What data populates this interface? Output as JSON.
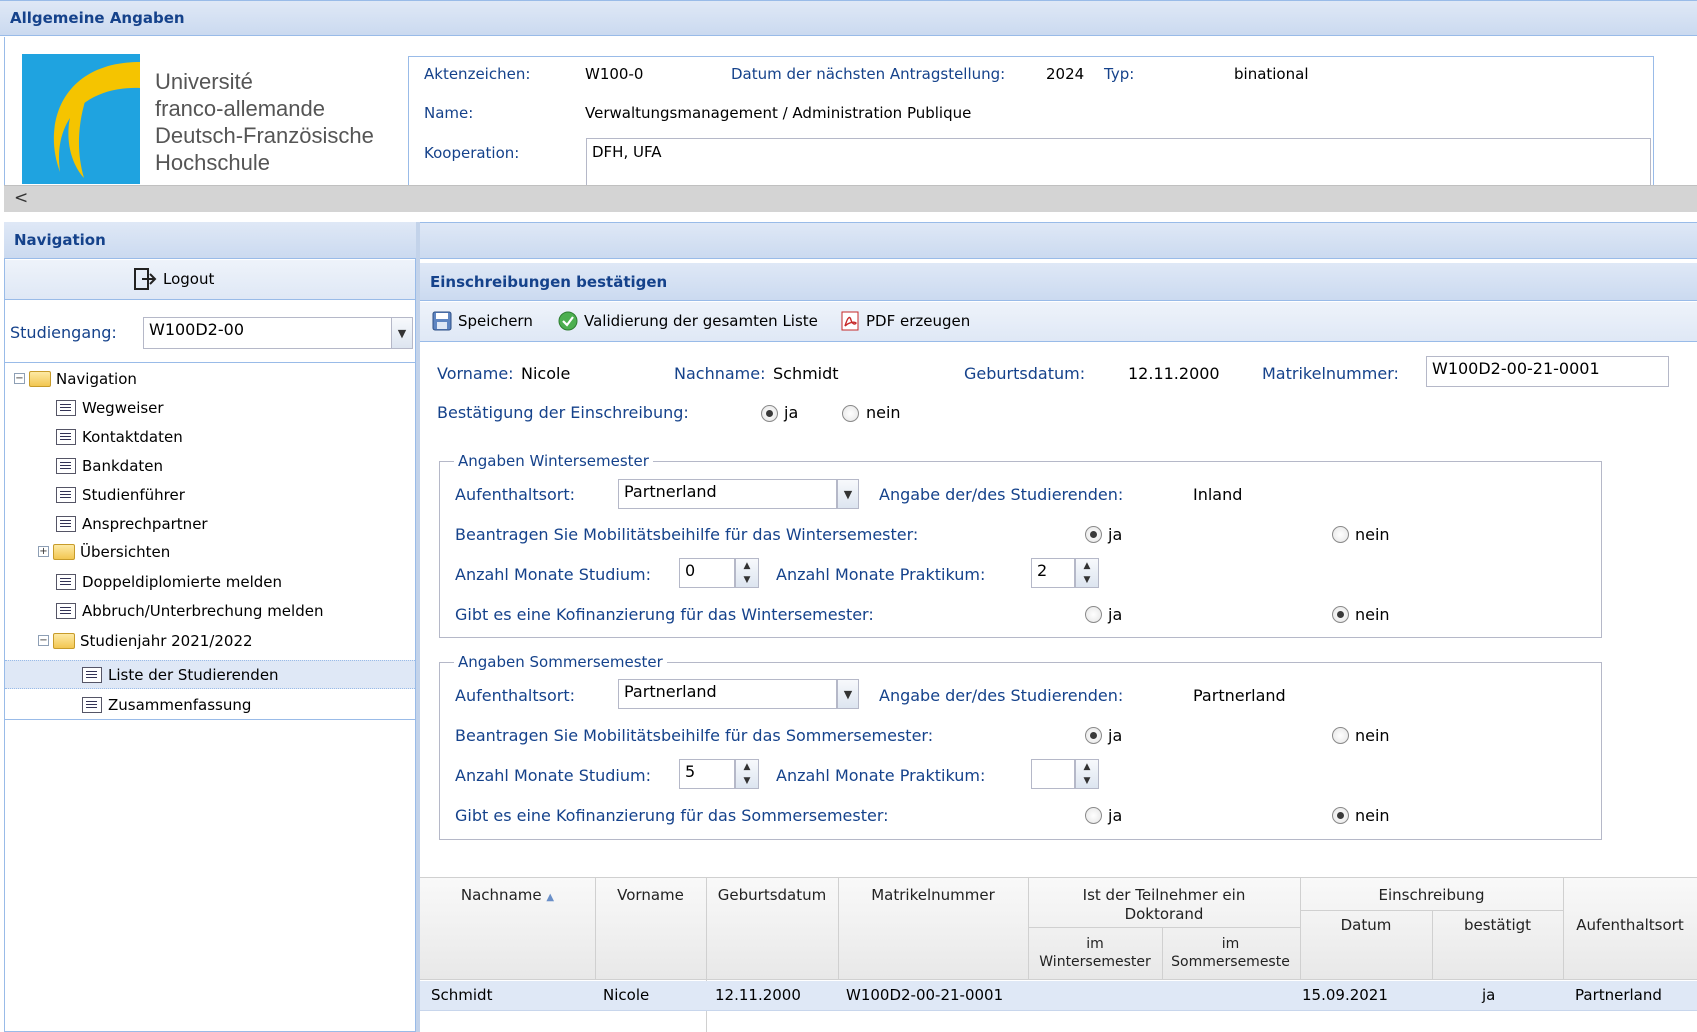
{
  "top_panel": {
    "title": "Allgemeine Angaben",
    "logo_text": [
      "Université",
      "franco-allemande",
      "Deutsch-Französische",
      "Hochschule"
    ],
    "aktenzeichen_label": "Aktenzeichen:",
    "aktenzeichen_value": "W100-0",
    "datum_label": "Datum der nächsten Antragstellung:",
    "datum_value": "2024",
    "typ_label": "Typ:",
    "typ_value": "binational",
    "name_label": "Name:",
    "name_value": "Verwaltungsmanagement / Administration Publique",
    "kooperation_label": "Kooperation:",
    "kooperation_value": "DFH, UFA",
    "scroll_left": "<"
  },
  "nav": {
    "title": "Navigation",
    "logout": "Logout",
    "studiengang_label": "Studiengang:",
    "studiengang_value": "W100D2-00",
    "tree": [
      {
        "label": "Navigation"
      },
      {
        "label": "Wegweiser"
      },
      {
        "label": "Kontaktdaten"
      },
      {
        "label": "Bankdaten"
      },
      {
        "label": "Studienführer"
      },
      {
        "label": "Ansprechpartner"
      },
      {
        "label": "Übersichten"
      },
      {
        "label": "Doppeldiplomierte melden"
      },
      {
        "label": "Abbruch/Unterbrechung melden"
      },
      {
        "label": "Studienjahr 2021/2022"
      },
      {
        "label": "Liste der Studierenden"
      },
      {
        "label": "Zusammenfassung"
      }
    ]
  },
  "main": {
    "title": "Einschreibungen bestätigen",
    "toolbar": {
      "save": "Speichern",
      "validate": "Validierung der gesamten Liste",
      "pdf": "PDF erzeugen"
    },
    "person": {
      "vorname_label": "Vorname:",
      "vorname_value": "Nicole",
      "nachname_label": "Nachname:",
      "nachname_value": "Schmidt",
      "geburtsdatum_label": "Geburtsdatum:",
      "geburtsdatum_value": "12.11.2000",
      "matrikel_label": "Matrikelnummer:",
      "matrikel_value": "W100D2-00-21-0001",
      "bestaetigung_label": "Bestätigung der Einschreibung:",
      "ja": "ja",
      "nein": "nein"
    },
    "winter": {
      "legend": "Angaben Wintersemester",
      "aufenthaltsort_label": "Aufenthaltsort:",
      "aufenthaltsort_value": "Partnerland",
      "angabe_label": "Angabe der/des Studierenden:",
      "angabe_value": "Inland",
      "mobilitaet_label": "Beantragen Sie Mobilitätsbeihilfe für das Wintersemester:",
      "monate_studium_label": "Anzahl Monate Studium:",
      "monate_studium_value": "0",
      "monate_praktikum_label": "Anzahl Monate Praktikum:",
      "monate_praktikum_value": "2",
      "kofinanzierung_label": "Gibt es eine Kofinanzierung für das Wintersemester:",
      "ja": "ja",
      "nein": "nein"
    },
    "summer": {
      "legend": "Angaben Sommersemester",
      "aufenthaltsort_label": "Aufenthaltsort:",
      "aufenthaltsort_value": "Partnerland",
      "angabe_label": "Angabe der/des Studierenden:",
      "angabe_value": "Partnerland",
      "mobilitaet_label": "Beantragen Sie Mobilitätsbeihilfe für das Sommersemester:",
      "monate_studium_label": "Anzahl Monate Studium:",
      "monate_studium_value": "5",
      "monate_praktikum_label": "Anzahl Monate Praktikum:",
      "monate_praktikum_value": "",
      "kofinanzierung_label": "Gibt es eine Kofinanzierung für das Sommersemester:",
      "ja": "ja",
      "nein": "nein"
    },
    "grid": {
      "headers": {
        "nachname": "Nachname",
        "vorname": "Vorname",
        "geburtsdatum": "Geburtsdatum",
        "matrikel": "Matrikelnummer",
        "doktorand": "Ist der Teilnehmer ein Doktorand",
        "im_ws": "im Wintersemester",
        "im_ss": "im Sommersemeste",
        "einschreibung": "Einschreibung",
        "datum": "Datum",
        "bestaetigt": "bestätigt",
        "aufenthaltsort": "Aufenthaltsort",
        "sort_indicator": "▲"
      },
      "rows": [
        {
          "nachname": "Schmidt",
          "vorname": "Nicole",
          "geburtsdatum": "12.11.2000",
          "matrikel": "W100D2-00-21-0001",
          "datum": "15.09.2021",
          "bestaetigt": "ja",
          "aufenthaltsort": "Partnerland"
        }
      ]
    }
  },
  "colors": {
    "header_text": "#15428b",
    "panel_border": "#99bbe8",
    "logo_blue": "#1fa3e0",
    "logo_yellow": "#f5c400"
  }
}
